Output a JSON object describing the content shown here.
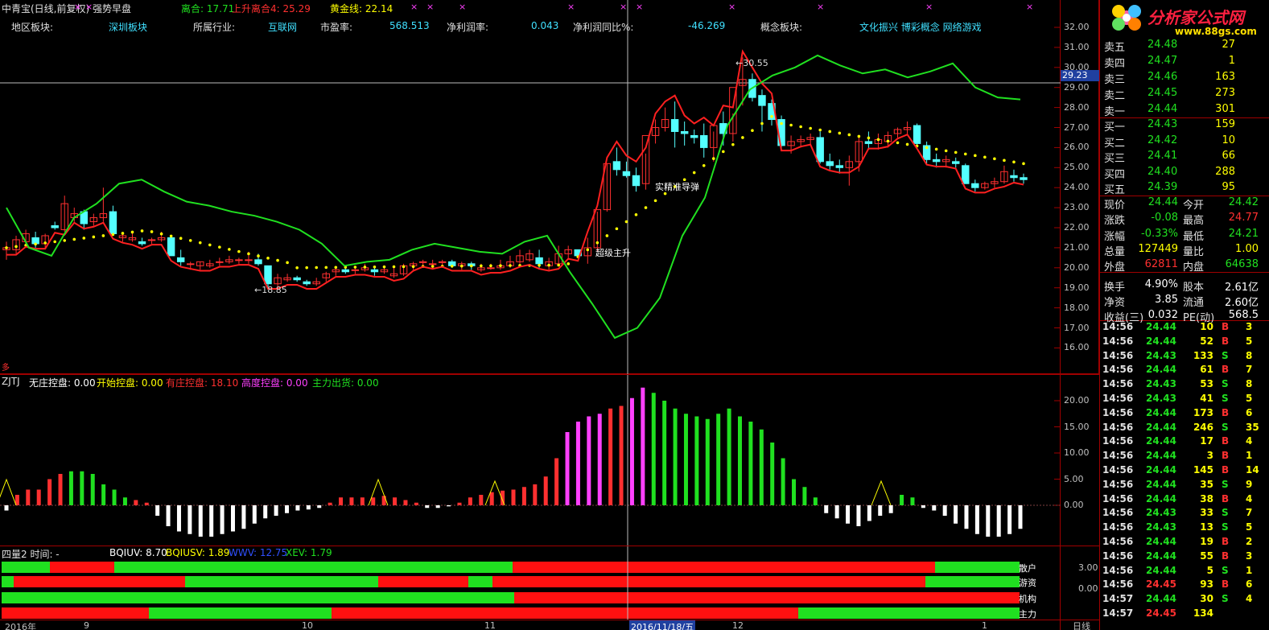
{
  "header": {
    "title": "中青宝(日线,前复权) 强势早盘",
    "indicators": [
      {
        "label": "离合: 17.71",
        "color": "#20e020"
      },
      {
        "label": "上升离合4: 25.29",
        "color": "#ff3030"
      },
      {
        "label": "黄金线: 22.14",
        "color": "#ffff00"
      }
    ],
    "info_row": [
      {
        "label": "地区板块:",
        "value": "深圳板块"
      },
      {
        "label": "所属行业:",
        "value": "互联网"
      },
      {
        "label": "市盈率:",
        "value": "568.513"
      },
      {
        "label": "净利润率:",
        "value": "0.043"
      },
      {
        "label": "净利润同比%:",
        "value": "-46.269"
      },
      {
        "label": "概念板块:",
        "value": "文化振兴 博彩概念 网络游戏"
      }
    ]
  },
  "main_chart": {
    "price_axis": [
      "32.00",
      "31.00",
      "30.00",
      "29.00",
      "28.00",
      "27.00",
      "26.00",
      "25.00",
      "24.00",
      "23.00",
      "22.00",
      "21.00",
      "20.00",
      "19.00",
      "18.00",
      "17.00",
      "16.00"
    ],
    "crosshair_value": "29.23",
    "annotations": {
      "high": "30.55",
      "low": "18.85",
      "signal1": "实精准导弹",
      "signal2": "超级主升",
      "marker": "多"
    },
    "colors": {
      "green_line": "#20e020",
      "red_line": "#ff2020",
      "dots": "#ffff00",
      "up_candle": "#ff3030",
      "down_candle": "#54ffff"
    }
  },
  "zjtj": {
    "title": "ZJTJ",
    "legend": [
      {
        "label": "无庄控盘: 0.00",
        "color": "#ffffff"
      },
      {
        "label": "开始控盘: 0.00",
        "color": "#ffff00"
      },
      {
        "label": "有庄控盘: 18.10",
        "color": "#ff3030"
      },
      {
        "label": "高度控盘: 0.00",
        "color": "#ff40ff"
      },
      {
        "label": "主力出货: 0.00",
        "color": "#20e020"
      }
    ],
    "axis": [
      "20.00",
      "15.00",
      "10.00",
      "5.00",
      "0.00"
    ]
  },
  "silian": {
    "title": "四量2 时间: -",
    "legend": [
      {
        "label": "BQIUV: 8.70",
        "color": "#ffffff"
      },
      {
        "label": "BQIUSV: 1.89",
        "color": "#ffff00"
      },
      {
        "label": "WWV: 12.75",
        "color": "#3050ff"
      },
      {
        "label": "XEV: 1.79",
        "color": "#20e020"
      }
    ],
    "rows": [
      "散户",
      "游资",
      "机构",
      "主力"
    ],
    "axis": [
      "3.00",
      "0.00"
    ]
  },
  "time_axis": {
    "labels": [
      "2016年",
      "9",
      "10",
      "11",
      "2016/11/18/五",
      "12",
      "1"
    ],
    "period": "日线"
  },
  "orderbook": {
    "asks": [
      {
        "name": "卖五",
        "price": "24.48",
        "vol": "27"
      },
      {
        "name": "卖四",
        "price": "24.47",
        "vol": "1"
      },
      {
        "name": "卖三",
        "price": "24.46",
        "vol": "163"
      },
      {
        "name": "卖二",
        "price": "24.45",
        "vol": "273"
      },
      {
        "name": "卖一",
        "price": "24.44",
        "vol": "301"
      }
    ],
    "bids": [
      {
        "name": "买一",
        "price": "24.43",
        "vol": "159"
      },
      {
        "name": "买二",
        "price": "24.42",
        "vol": "10"
      },
      {
        "name": "买三",
        "price": "24.41",
        "vol": "66"
      },
      {
        "name": "买四",
        "price": "24.40",
        "vol": "288"
      },
      {
        "name": "买五",
        "price": "24.39",
        "vol": "95"
      }
    ]
  },
  "quote": [
    {
      "k1": "现价",
      "v1": "24.44",
      "c1": "#20e020",
      "k2": "今开",
      "v2": "24.42",
      "c2": "#20e020"
    },
    {
      "k1": "涨跌",
      "v1": "-0.08",
      "c1": "#20e020",
      "k2": "最高",
      "v2": "24.77",
      "c2": "#ff3030"
    },
    {
      "k1": "涨幅",
      "v1": "-0.33%",
      "c1": "#20e020",
      "k2": "最低",
      "v2": "24.21",
      "c2": "#20e020"
    },
    {
      "k1": "总量",
      "v1": "127449",
      "c1": "#ffff00",
      "k2": "量比",
      "v2": "1.00",
      "c2": "#ffff00"
    },
    {
      "k1": "外盘",
      "v1": "62811",
      "c1": "#ff3030",
      "k2": "内盘",
      "v2": "64638",
      "c2": "#20e020"
    },
    {
      "k1": "换手",
      "v1": "4.90%",
      "c1": "#ffffff",
      "k2": "股本",
      "v2": "2.61亿",
      "c2": "#ffffff"
    },
    {
      "k1": "净资",
      "v1": "3.85",
      "c1": "#ffffff",
      "k2": "流通",
      "v2": "2.60亿",
      "c2": "#ffffff"
    },
    {
      "k1": "收益(三)",
      "v1": "0.032",
      "c1": "#ffffff",
      "k2": "PE(动)",
      "v2": "568.5",
      "c2": "#ffffff"
    }
  ],
  "ticks": [
    {
      "t": "14:56",
      "p": "24.44",
      "v": "10",
      "s": "B",
      "n": "3"
    },
    {
      "t": "14:56",
      "p": "24.44",
      "v": "52",
      "s": "B",
      "n": "5"
    },
    {
      "t": "14:56",
      "p": "24.43",
      "v": "133",
      "s": "S",
      "n": "8"
    },
    {
      "t": "14:56",
      "p": "24.44",
      "v": "61",
      "s": "B",
      "n": "7"
    },
    {
      "t": "14:56",
      "p": "24.43",
      "v": "53",
      "s": "S",
      "n": "8"
    },
    {
      "t": "14:56",
      "p": "24.43",
      "v": "41",
      "s": "S",
      "n": "5"
    },
    {
      "t": "14:56",
      "p": "24.44",
      "v": "173",
      "s": "B",
      "n": "6"
    },
    {
      "t": "14:56",
      "p": "24.44",
      "v": "246",
      "s": "S",
      "n": "35"
    },
    {
      "t": "14:56",
      "p": "24.44",
      "v": "17",
      "s": "B",
      "n": "4"
    },
    {
      "t": "14:56",
      "p": "24.44",
      "v": "3",
      "s": "B",
      "n": "1"
    },
    {
      "t": "14:56",
      "p": "24.44",
      "v": "145",
      "s": "B",
      "n": "14"
    },
    {
      "t": "14:56",
      "p": "24.44",
      "v": "35",
      "s": "S",
      "n": "9"
    },
    {
      "t": "14:56",
      "p": "24.44",
      "v": "38",
      "s": "B",
      "n": "4"
    },
    {
      "t": "14:56",
      "p": "24.43",
      "v": "33",
      "s": "S",
      "n": "7"
    },
    {
      "t": "14:56",
      "p": "24.43",
      "v": "13",
      "s": "S",
      "n": "5"
    },
    {
      "t": "14:56",
      "p": "24.44",
      "v": "19",
      "s": "B",
      "n": "2"
    },
    {
      "t": "14:56",
      "p": "24.44",
      "v": "55",
      "s": "B",
      "n": "3"
    },
    {
      "t": "14:56",
      "p": "24.44",
      "v": "5",
      "s": "S",
      "n": "1"
    },
    {
      "t": "14:56",
      "p": "24.45",
      "v": "93",
      "s": "B",
      "n": "6"
    },
    {
      "t": "14:57",
      "p": "24.44",
      "v": "30",
      "s": "S",
      "n": "4"
    },
    {
      "t": "14:57",
      "p": "24.45",
      "v": "134",
      "s": "",
      "n": ""
    }
  ],
  "logo": {
    "title": "分析家公式网",
    "url": "www.88gs.com"
  }
}
